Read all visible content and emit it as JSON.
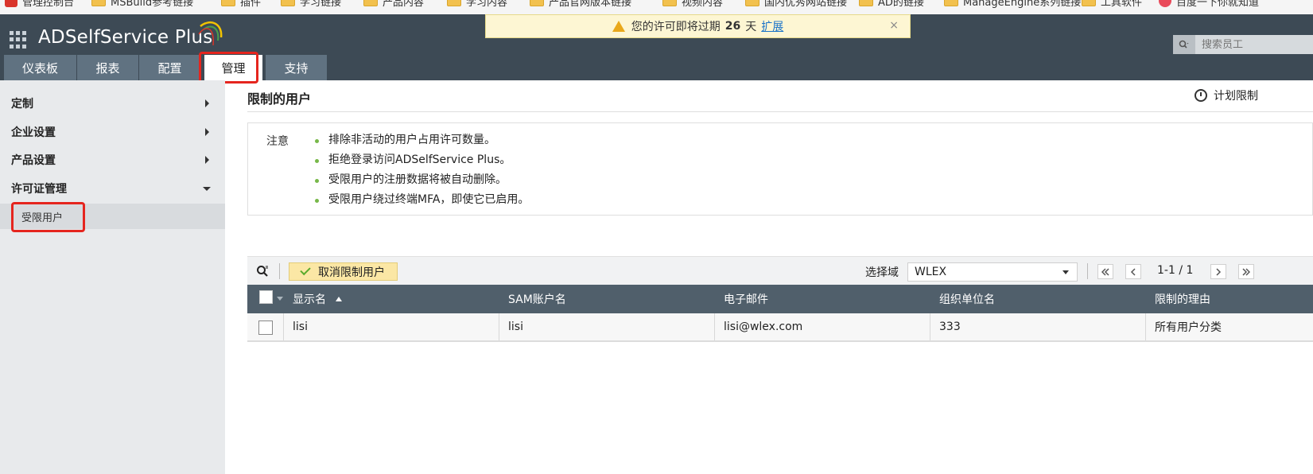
{
  "bookmarks": [
    "管理控制台",
    "MSBuild参考链接",
    "插件",
    "学习链接",
    "产品内容",
    "学习内容",
    "产品官网版本链接",
    "视频内容",
    "国内优秀网站链接",
    "AD的链接",
    "ManageEngine系列链接",
    "工具软件",
    "百度一下你就知道"
  ],
  "header": {
    "logo_text": "ADSelfService Plus",
    "tabs": [
      "仪表板",
      "报表",
      "配置",
      "管理",
      "支持"
    ],
    "active_tab": "管理"
  },
  "notification": {
    "text_before": "您的许可即将过期",
    "days": "26",
    "days_unit": "天",
    "extend_link": "扩展",
    "close": "×"
  },
  "top_search": {
    "placeholder": "搜索员工"
  },
  "sidebar": {
    "items": [
      {
        "label": "定制",
        "expanded": false
      },
      {
        "label": "企业设置",
        "expanded": false
      },
      {
        "label": "产品设置",
        "expanded": false
      },
      {
        "label": "许可证管理",
        "expanded": true
      }
    ],
    "sub_item": "受限用户"
  },
  "main": {
    "title": "限制的用户",
    "schedule_label": "计划限制",
    "note_label": "注意",
    "notes": [
      "排除非活动的用户占用许可数量。",
      "拒绝登录访问ADSelfService Plus。",
      "受限用户的注册数据将被自动删除。",
      "受限用户绕过终端MFA，即使它已启用。"
    ]
  },
  "toolbar": {
    "unrestrict_label": "取消限制用户",
    "domain_label": "选择域",
    "domain_value": "WLEX",
    "pagination": "1-1 / 1"
  },
  "table": {
    "columns": [
      "显示名",
      "SAM账户名",
      "电子邮件",
      "组织单位名",
      "限制的理由"
    ],
    "rows": [
      {
        "display_name": "lisi",
        "sam": "lisi",
        "email": "lisi@wlex.com",
        "ou": "333",
        "reason": "所有用户分类"
      }
    ]
  },
  "colors": {
    "header_bg": "#3d4a55",
    "tab_bg": "#607281",
    "highlight_red": "#e5251e",
    "table_header_bg": "#505f6b",
    "button_yellow": "#fbe7a5",
    "bullet_green": "#77b849"
  }
}
